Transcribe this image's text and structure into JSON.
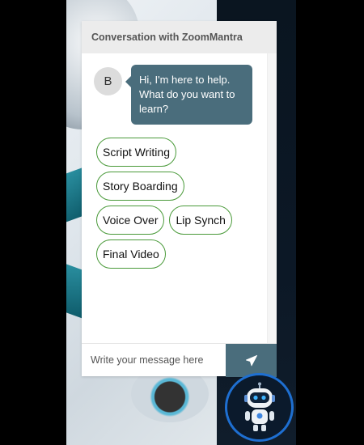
{
  "header": {
    "title": "Conversation with ZoomMantra"
  },
  "message": {
    "avatar_letter": "B",
    "text": "Hi, I'm here to help. What do you want to learn?"
  },
  "options": [
    [
      "Script Writing"
    ],
    [
      "Story Boarding"
    ],
    [
      "Voice Over",
      "Lip Synch"
    ],
    [
      "Final Video"
    ]
  ],
  "input": {
    "placeholder": "Write your message here",
    "value": ""
  },
  "icons": {
    "send": "paper-plane-icon",
    "launcher": "robot-icon"
  },
  "colors": {
    "accent": "#4a6d7c",
    "option_border": "#4a9a3a",
    "launcher_ring": "#1e6fd1"
  }
}
